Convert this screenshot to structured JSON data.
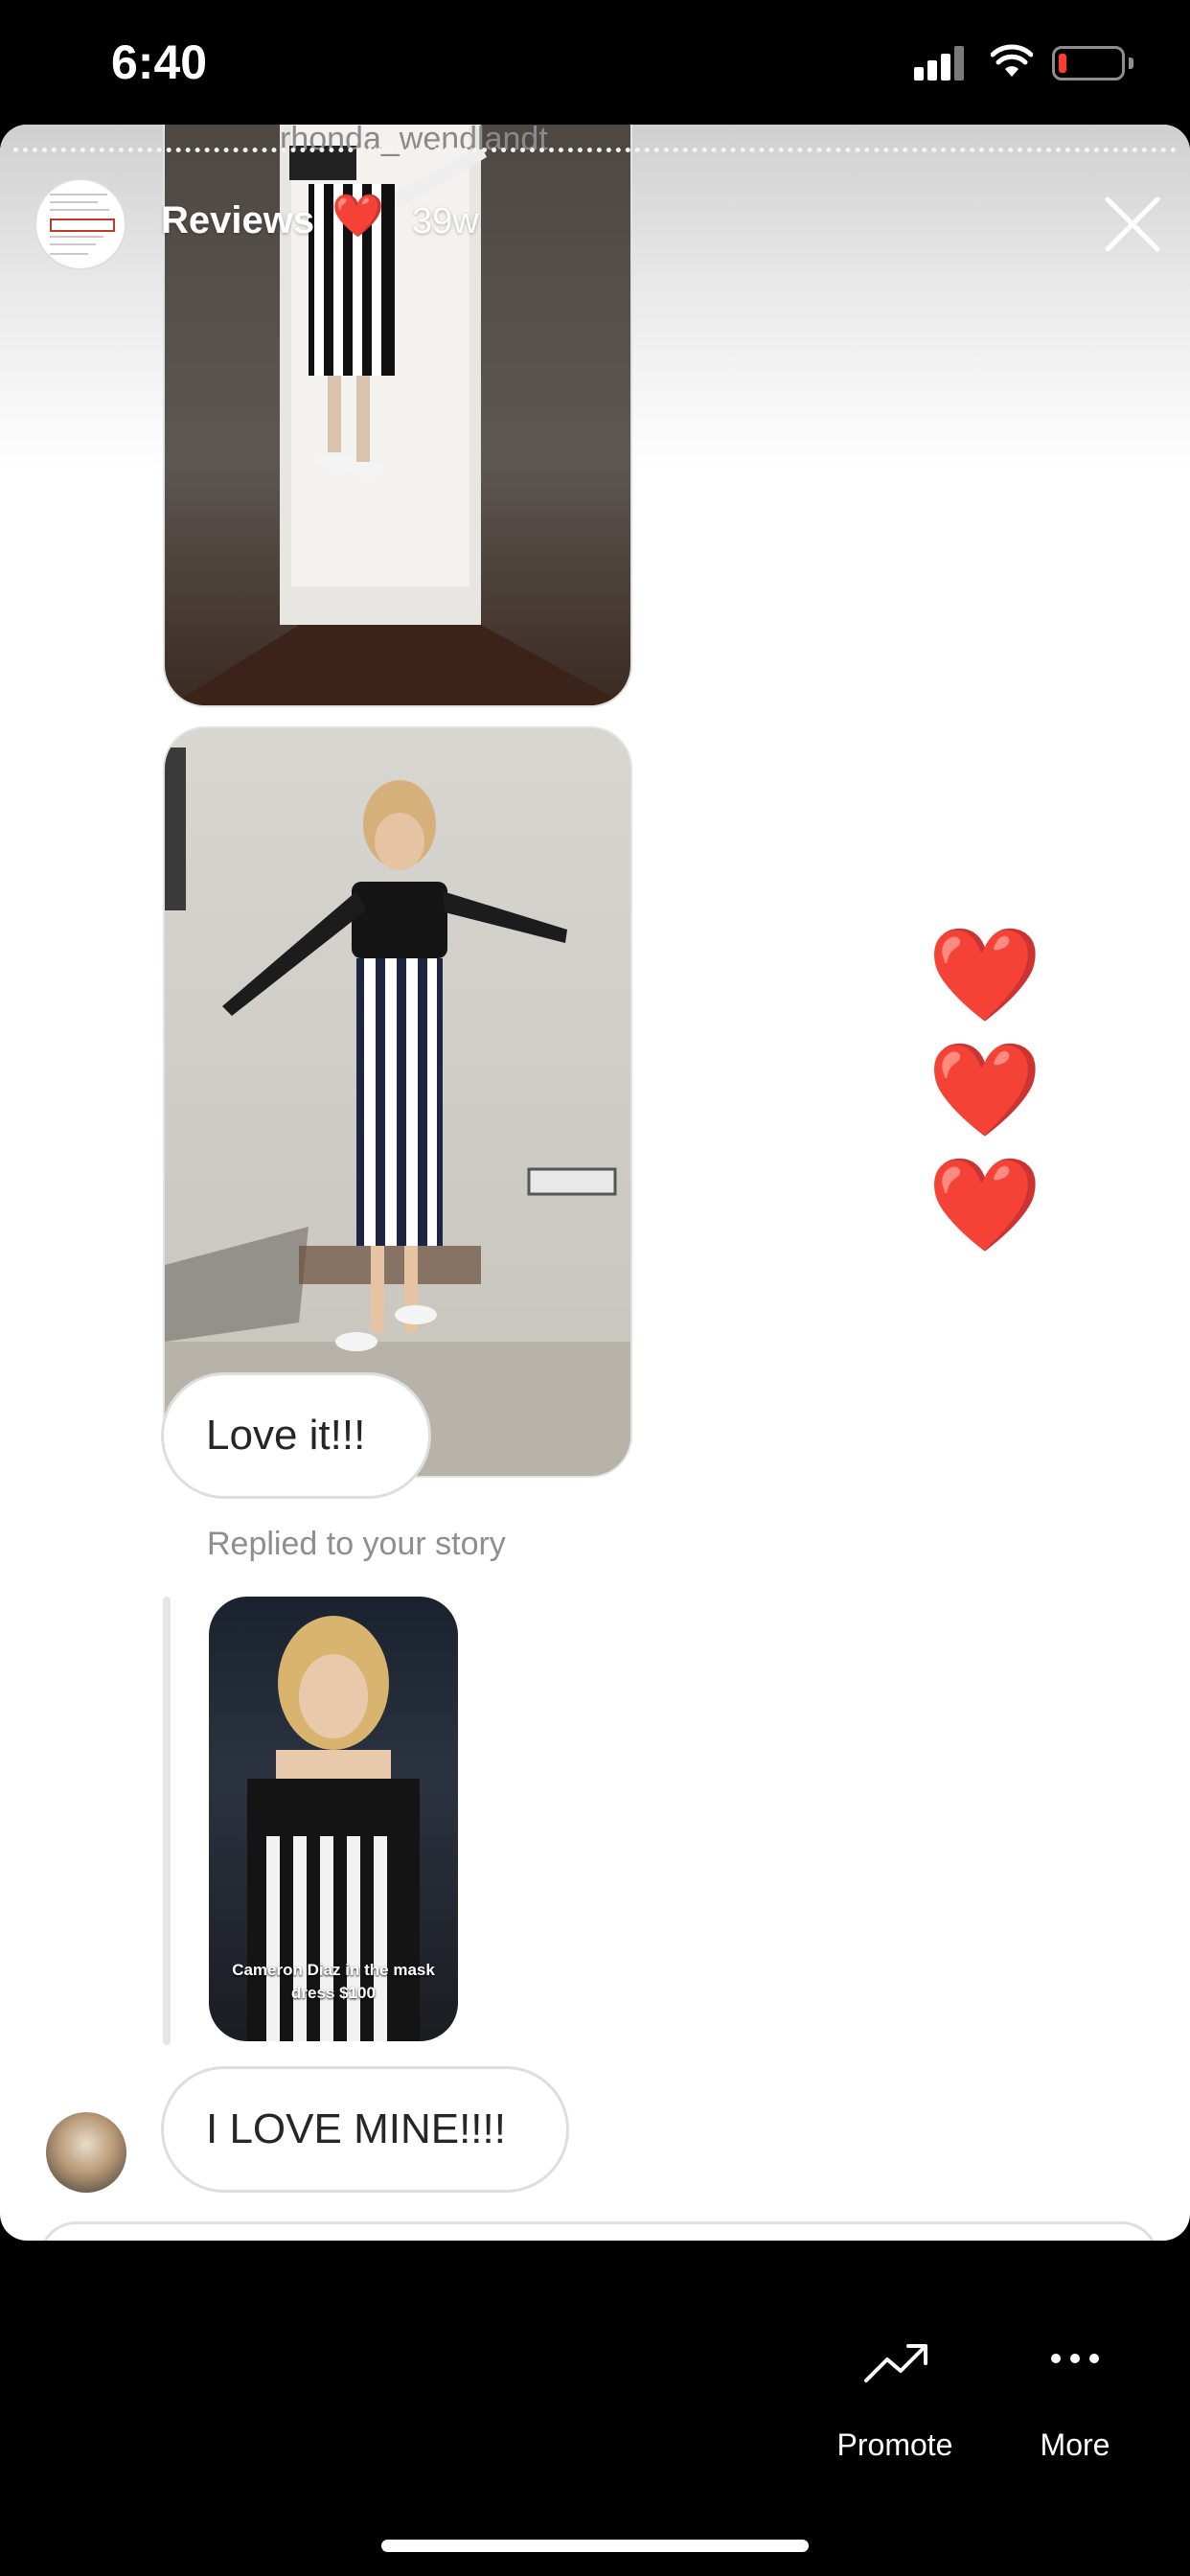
{
  "status_bar": {
    "time": "6:40"
  },
  "story_header": {
    "underlying_username": "rhonda_wendlandt",
    "title": "Reviews",
    "title_emoji": "❤️",
    "age": "39w"
  },
  "messages": {
    "bubble_1": "Love it!!!",
    "reply_label": "Replied to your story",
    "reply_story_caption": "Cameron Diaz in the mask dress $100",
    "bubble_2": "I LOVE MINE!!!!"
  },
  "reactions": {
    "hearts": [
      "❤️",
      "❤️",
      "❤️"
    ]
  },
  "bottom_bar": {
    "promote_label": "Promote",
    "more_label": "More"
  },
  "colors": {
    "heart": "#e0242c",
    "bubble_border": "#dedede",
    "secondary_text": "#8e8e8e"
  }
}
